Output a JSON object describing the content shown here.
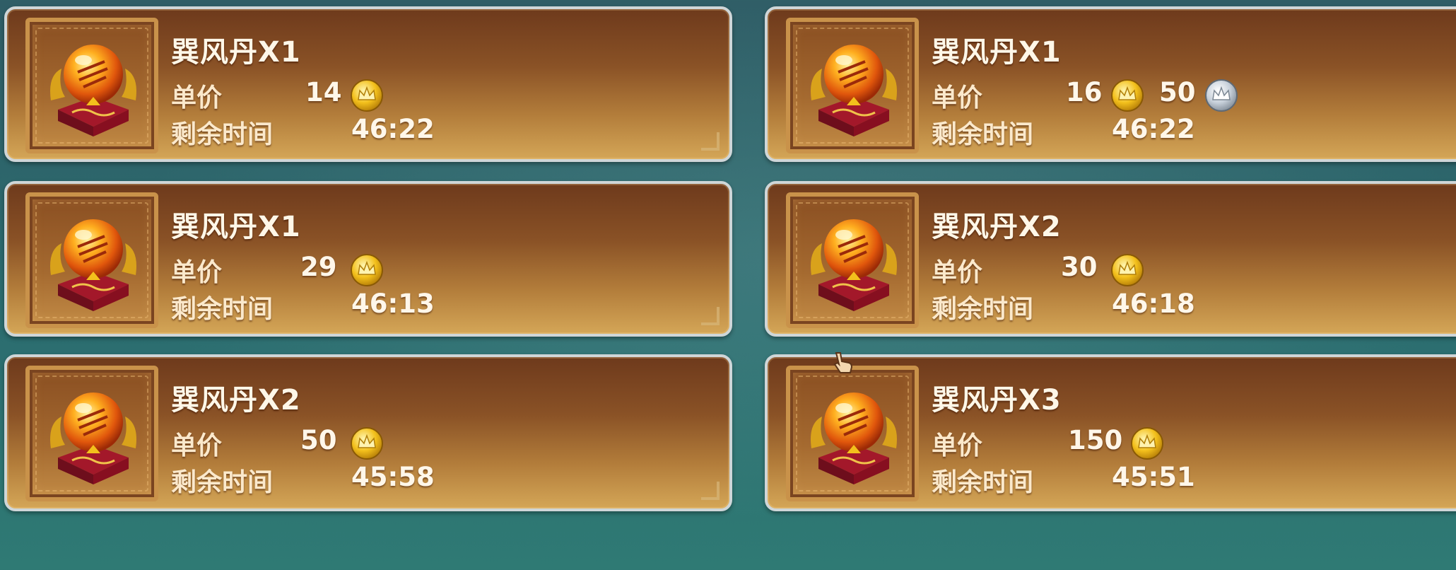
{
  "listings": [
    {
      "name": "巽风丹X1",
      "price_label": "单价",
      "price": "14",
      "price_currency": "gold-coin-icon",
      "time_label": "剩余时间",
      "time_left": "46:22"
    },
    {
      "name": "巽风丹X1",
      "price_label": "单价",
      "price": "16",
      "price_currency": "gold-coin-icon",
      "price2": "50",
      "price2_currency": "silver-coin-icon",
      "time_label": "剩余时间",
      "time_left": "46:22"
    },
    {
      "name": "巽风丹X1",
      "price_label": "单价",
      "price": "29",
      "price_currency": "gold-coin-icon",
      "time_label": "剩余时间",
      "time_left": "46:13"
    },
    {
      "name": "巽风丹X2",
      "price_label": "单价",
      "price": "30",
      "price_currency": "gold-coin-icon",
      "time_label": "剩余时间",
      "time_left": "46:18"
    },
    {
      "name": "巽风丹X2",
      "price_label": "单价",
      "price": "50",
      "price_currency": "gold-coin-icon",
      "time_label": "剩余时间",
      "time_left": "45:58"
    },
    {
      "name": "巽风丹X3",
      "price_label": "单价",
      "price": "150",
      "price_currency": "gold-coin-icon",
      "time_label": "剩余时间",
      "time_left": "45:51"
    }
  ],
  "colors": {
    "card_top": "#6e3a1c",
    "card_bottom": "#d4a657",
    "card_border": "#cfd6d8",
    "background": "#2f6c70"
  }
}
